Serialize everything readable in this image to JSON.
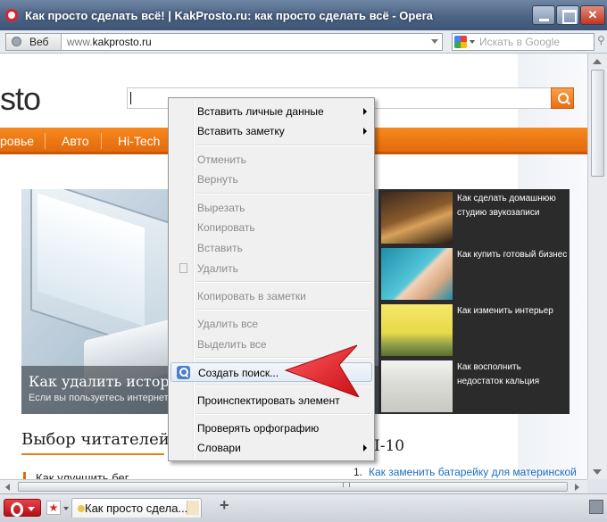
{
  "window": {
    "title": "Как просто сделать всё! | KakProsto.ru: как просто сделать всё - Opera"
  },
  "address_bar": {
    "web_label": "Веб",
    "url_prefix": "www.",
    "url_domain": "kakprosto.ru",
    "search_placeholder": "Искать в Google"
  },
  "page": {
    "logo_partial": "sto",
    "nav": [
      "ровье",
      "Авто",
      "Hi-Tech"
    ],
    "hero": {
      "title": "Как удалить историю з",
      "subtitle": "Если вы пользуетесь интернетом"
    },
    "side_items": [
      {
        "text": "Как сделать домашнюю студию звукозаписи"
      },
      {
        "text": "Как купить готовый бизнес"
      },
      {
        "text": "Как изменить интерьер"
      },
      {
        "text": "Как восполнить недостаток кальция"
      }
    ],
    "section_title": "Выбор читателей",
    "section_title_2": "I-10",
    "list_number": "1.",
    "list_link": "Как заменить батарейку для материнской",
    "partial_link": "Как улучшить бег"
  },
  "context_menu": {
    "items": [
      {
        "label": "Вставить личные данные",
        "disabled": false,
        "submenu": true
      },
      {
        "label": "Вставить заметку",
        "disabled": false,
        "submenu": true
      },
      {
        "label": "Отменить",
        "disabled": true
      },
      {
        "label": "Вернуть",
        "disabled": true
      },
      {
        "label": "Вырезать",
        "disabled": true
      },
      {
        "label": "Копировать",
        "disabled": true
      },
      {
        "label": "Вставить",
        "disabled": true
      },
      {
        "label": "Удалить",
        "disabled": true
      },
      {
        "label": "Копировать в заметки",
        "disabled": true
      },
      {
        "label": "Удалить все",
        "disabled": true
      },
      {
        "label": "Выделить все",
        "disabled": true
      },
      {
        "label": "Создать поиск...",
        "disabled": false,
        "highlighted": true
      },
      {
        "label": "Проинспектировать элемент",
        "disabled": false
      },
      {
        "label": "Проверять орфографию",
        "disabled": false
      },
      {
        "label": "Словари",
        "disabled": false,
        "submenu": true
      }
    ]
  },
  "tab_bar": {
    "tab_label": "Как просто сдела...",
    "add_tab": "+"
  },
  "colors": {
    "site_accent": "#e36a0c",
    "annotation_arrow": "#e8141b",
    "link": "#1f6ec0"
  }
}
